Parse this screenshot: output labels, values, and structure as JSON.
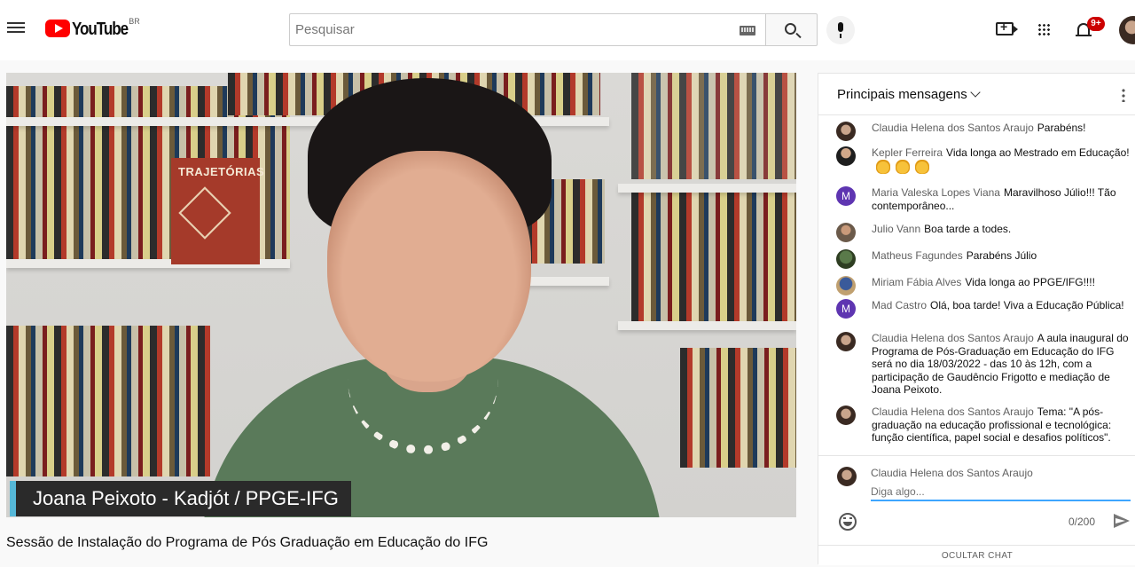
{
  "header": {
    "logo_text": "YouTube",
    "logo_country": "BR",
    "search_placeholder": "Pesquisar",
    "notification_badge": "9+"
  },
  "video": {
    "caption": "Joana Peixoto - Kadjót / PPGE-IFG",
    "book_cover_title": "TRAJETÓRIAS",
    "title": "Sessão de Instalação do Programa de Pós Graduação em Educação do IFG"
  },
  "chat": {
    "header_title": "Principais mensagens",
    "messages": [
      {
        "author": "Claudia Helena dos Santos Araujo",
        "text": "Parabéns!"
      },
      {
        "author": "Kepler Ferreira",
        "text": "Vida longa ao Mestrado em Educação!"
      },
      {
        "author": "Maria Valeska Lopes Viana",
        "text": "Maravilhoso Júlio!!! Tão contemporâneo...",
        "avatar_letter": "M"
      },
      {
        "author": "Julio Vann",
        "text": "Boa tarde a todes."
      },
      {
        "author": "Matheus Fagundes",
        "text": "Parabéns Júlio"
      },
      {
        "author": "Miriam Fábia Alves",
        "text": "Vida longa ao PPGE/IFG!!!!"
      },
      {
        "author": "Mad Castro",
        "text": "Olá, boa tarde! Viva a Educação Pública!",
        "avatar_letter": "M"
      },
      {
        "author": "Claudia Helena dos Santos Araujo",
        "text": "A aula inaugural do Programa de Pós-Graduação em Educação do IFG será no dia 18/03/2022 - das 10 às 12h, com a participação de Gaudêncio Frigotto e mediação de Joana Peixoto."
      },
      {
        "author": "Claudia Helena dos Santos Araujo",
        "text": "Tema: \"A pós-graduação na educação profissional e tecnológica: função científica, papel social e desafios políticos\"."
      }
    ],
    "compose": {
      "user_name": "Claudia Helena dos Santos Araujo",
      "placeholder": "Diga algo...",
      "counter": "0/200"
    },
    "hide_label": "OCULTAR CHAT"
  },
  "colors": {
    "brand_red": "#ff0000",
    "accent_blue": "#3ea6ff",
    "badge_red": "#cc0000",
    "avatar_purple": "#5e35b1"
  }
}
